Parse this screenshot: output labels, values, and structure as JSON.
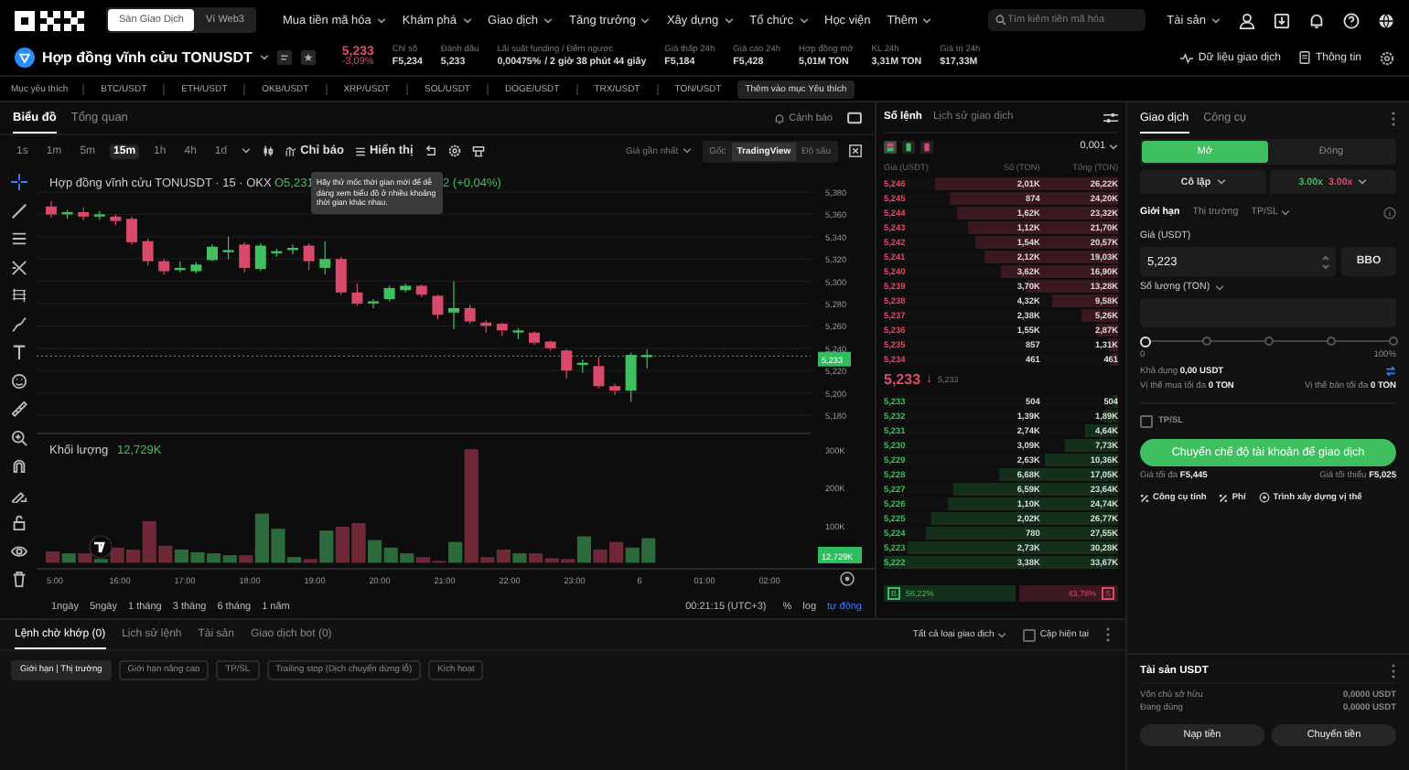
{
  "nav": {
    "exchange_tabs": [
      {
        "label": "Sàn Giao Dịch",
        "selected": true
      },
      {
        "label": "Ví Web3",
        "selected": false
      }
    ],
    "menu": [
      {
        "label": "Mua tiền mã hóa",
        "dropdown": true
      },
      {
        "label": "Khám phá",
        "dropdown": true
      },
      {
        "label": "Giao dịch",
        "dropdown": true
      },
      {
        "label": "Tăng trưởng",
        "dropdown": true
      },
      {
        "label": "Xây dựng",
        "dropdown": true
      },
      {
        "label": "Tổ chức",
        "dropdown": true
      },
      {
        "label": "Học viện",
        "dropdown": false
      },
      {
        "label": "Thêm",
        "dropdown": true
      }
    ],
    "search": {
      "placeholder": "Tìm kiếm tiền mã hóa"
    },
    "assets": "Tài sản"
  },
  "ticker": {
    "title": "Hợp đồng vĩnh cửu TONUSDT",
    "price": "5,233",
    "change": "-3,09%",
    "stats": [
      {
        "kind": "plain",
        "label": "Chỉ số",
        "value": "F5,234"
      },
      {
        "kind": "plain",
        "label": "Đánh dấu",
        "value": "5,233"
      },
      {
        "kind": "funding",
        "label": "Lãi suất funding / Đếm ngược",
        "rate": "0,00475%",
        "countdown": "/ 2 giờ 38 phút 44 giây"
      },
      {
        "kind": "plain",
        "label": "Giá thấp 24h",
        "value": "F5,184"
      },
      {
        "kind": "plain",
        "label": "Giá cao 24h",
        "value": "F5,428"
      },
      {
        "kind": "plain",
        "label": "Hợp đồng mở",
        "value": "5,01M TON"
      },
      {
        "kind": "plain",
        "label": "KL 24h",
        "value": "3,31M TON"
      },
      {
        "kind": "plain",
        "label": "Giá trị 24h",
        "value": "$17,33M"
      }
    ],
    "actions": [
      "Dữ liệu giao dịch",
      "Thông tin"
    ]
  },
  "favorites": {
    "label": "Mục yêu thích",
    "pairs": [
      "BTC/USDT",
      "ETH/USDT",
      "OKB/USDT",
      "XRP/USDT",
      "SOL/USDT",
      "DOGE/USDT",
      "TRX/USDT",
      "TON/USDT"
    ],
    "add_button": "Thêm vào mục Yêu thích"
  },
  "chart": {
    "tabs": [
      {
        "label": "Biểu đồ",
        "selected": true
      },
      {
        "label": "Tổng quan",
        "selected": false
      }
    ],
    "alert": "Cảnh báo",
    "timeframes": [
      {
        "label": "1s",
        "selected": false
      },
      {
        "label": "1m",
        "selected": false
      },
      {
        "label": "5m",
        "selected": false
      },
      {
        "label": "15m",
        "selected": true
      },
      {
        "label": "1h",
        "selected": false
      },
      {
        "label": "4h",
        "selected": false
      },
      {
        "label": "1d",
        "selected": false
      }
    ],
    "indicators": "Chỉ báo",
    "display": "Hiển thị",
    "price_source": "Giá gần nhất",
    "views": [
      {
        "label": "Gốc",
        "selected": false
      },
      {
        "label": "TradingView",
        "selected": true
      },
      {
        "label": "Độ sâu",
        "selected": false
      }
    ],
    "legend": {
      "title": "Hợp đồng vĩnh cửu TONUSDT · 15 · OKX",
      "open": "O5,231",
      "change": "2 (+0,04%)"
    },
    "tooltip": "Hãy thử mốc thời gian mới để dễ dàng xem biểu đồ ở nhiều khoảng thời gian khác nhau.",
    "price_ticks": [
      "5,380",
      "5,360",
      "5,340",
      "5,320",
      "5,300",
      "5,280",
      "5,260",
      "5,240",
      "5,220",
      "5,200",
      "5,180"
    ],
    "last_price": "5,233",
    "volume_label": "Khối lượng",
    "volume_value": "12,729K",
    "volume_ticks": [
      "300K",
      "200K",
      "100K"
    ],
    "volume_tag": "12,729K",
    "time_labels": [
      "5:00",
      "16:00",
      "17:00",
      "18:00",
      "19:00",
      "20:00",
      "21:00",
      "22:00",
      "23:00",
      "6",
      "01:00",
      "02:00"
    ],
    "ranges": [
      "1ngày",
      "5ngày",
      "1 tháng",
      "3 tháng",
      "6 tháng",
      "1 năm"
    ],
    "clock": "00:21:15 (UTC+3)",
    "scale_options": [
      {
        "label": "%",
        "selected": false
      },
      {
        "label": "log",
        "selected": false
      },
      {
        "label": "tự động",
        "selected": true
      }
    ]
  },
  "orderbook": {
    "tabs": [
      {
        "label": "Sổ lệnh",
        "selected": true
      },
      {
        "label": "Lịch sử giao dịch",
        "selected": false
      }
    ],
    "step": "0,001",
    "columns": [
      "Giá (USDT)",
      "Số (TON)",
      "Tổng (TON)"
    ],
    "asks": [
      {
        "price": "5,246",
        "size": "2,01K",
        "total": "26,22K",
        "level": 0.78
      },
      {
        "price": "5,245",
        "size": "874",
        "total": "24,20K",
        "level": 0.72
      },
      {
        "price": "5,244",
        "size": "1,62K",
        "total": "23,32K",
        "level": 0.69
      },
      {
        "price": "5,243",
        "size": "1,12K",
        "total": "21,70K",
        "level": 0.64
      },
      {
        "price": "5,242",
        "size": "1,54K",
        "total": "20,57K",
        "level": 0.61
      },
      {
        "price": "5,241",
        "size": "2,12K",
        "total": "19,03K",
        "level": 0.57
      },
      {
        "price": "5,240",
        "size": "3,62K",
        "total": "16,90K",
        "level": 0.5
      },
      {
        "price": "5,239",
        "size": "3,70K",
        "total": "13,28K",
        "level": 0.39
      },
      {
        "price": "5,238",
        "size": "4,32K",
        "total": "9,58K",
        "level": 0.28
      },
      {
        "price": "5,237",
        "size": "2,38K",
        "total": "5,26K",
        "level": 0.16
      },
      {
        "price": "5,236",
        "size": "1,55K",
        "total": "2,87K",
        "level": 0.09
      },
      {
        "price": "5,235",
        "size": "857",
        "total": "1,31K",
        "level": 0.04
      },
      {
        "price": "5,234",
        "size": "461",
        "total": "461",
        "level": 0.02
      }
    ],
    "last_price": "5,233",
    "arrow": "↓",
    "mark_price": "5,233",
    "bids": [
      {
        "price": "5,233",
        "size": "504",
        "total": "504",
        "level": 0.02
      },
      {
        "price": "5,232",
        "size": "1,39K",
        "total": "1,89K",
        "level": 0.06
      },
      {
        "price": "5,231",
        "size": "2,74K",
        "total": "4,64K",
        "level": 0.14
      },
      {
        "price": "5,230",
        "size": "3,09K",
        "total": "7,73K",
        "level": 0.23
      },
      {
        "price": "5,229",
        "size": "2,63K",
        "total": "10,36K",
        "level": 0.31
      },
      {
        "price": "5,228",
        "size": "6,68K",
        "total": "17,05K",
        "level": 0.51
      },
      {
        "price": "5,227",
        "size": "6,59K",
        "total": "23,64K",
        "level": 0.7
      },
      {
        "price": "5,226",
        "size": "1,10K",
        "total": "24,74K",
        "level": 0.73
      },
      {
        "price": "5,225",
        "size": "2,02K",
        "total": "26,77K",
        "level": 0.8
      },
      {
        "price": "5,224",
        "size": "780",
        "total": "27,55K",
        "level": 0.82
      },
      {
        "price": "5,223",
        "size": "2,73K",
        "total": "30,28K",
        "level": 0.9
      },
      {
        "price": "5,222",
        "size": "3,38K",
        "total": "33,67K",
        "level": 1
      }
    ],
    "ratio": {
      "buy_label": "B",
      "buy": "56,22%",
      "sell": "43,78%",
      "sell_label": "S",
      "level": 0.5622
    }
  },
  "trade": {
    "tabs": [
      {
        "label": "Giao dịch",
        "selected": true
      },
      {
        "label": "Công cụ",
        "selected": false
      }
    ],
    "sides": [
      {
        "label": "Mở",
        "selected": true
      },
      {
        "label": "Đóng",
        "selected": false
      }
    ],
    "margin_mode": "Cô lập",
    "leverage_long": "3.00x",
    "leverage_short": "3.00x",
    "order_types": [
      {
        "label": "Giới hạn",
        "selected": true,
        "dropdown": false
      },
      {
        "label": "Thị trường",
        "selected": false,
        "dropdown": false
      },
      {
        "label": "TP/SL",
        "selected": false,
        "dropdown": true
      }
    ],
    "price_label": "Giá (USDT)",
    "price_value": "5,223",
    "bbo": "BBO",
    "amount_label": "Số lượng (TON)",
    "slider": {
      "level": 0,
      "min": "0",
      "max": "100%"
    },
    "available_label": "Khả dụng",
    "available": "0,00 USDT",
    "max_buy_label": "Vị thế mua tối đa",
    "max_buy": "0 TON",
    "max_sell_label": "Vị thế bán tối đa",
    "max_sell": "0 TON",
    "tpsl": {
      "label": "TP/SL",
      "checked": false
    },
    "submit": "Chuyển chế độ tài khoản để giao dịch",
    "max_price_label": "Giá tối đa",
    "max_price": "F5,445",
    "min_price_label": "Giá tối thiểu",
    "min_price": "F5,025",
    "tools": [
      "Công cụ tính",
      "Phí",
      "Trình xây dựng vị thế"
    ]
  },
  "orders": {
    "tabs": [
      {
        "label": "Lệnh chờ khớp (0)",
        "selected": true
      },
      {
        "label": "Lịch sử lệnh",
        "selected": false
      },
      {
        "label": "Tài sản",
        "selected": false
      },
      {
        "label": "Giao dịch bot (0)",
        "selected": false
      }
    ],
    "filter": "Tất cả loại giao dịch",
    "current_pair": {
      "label": "Cặp hiện tại",
      "checked": false
    },
    "chips": [
      {
        "label": "Giới hạn | Thị trường",
        "selected": true
      },
      {
        "label": "Giới hạn nâng cao",
        "selected": false
      },
      {
        "label": "TP/SL",
        "selected": false
      },
      {
        "label": "Trailing stop (Dịch chuyển dừng lỗ)",
        "selected": false
      },
      {
        "label": "Kích hoạt",
        "selected": false
      }
    ]
  },
  "assets": {
    "title": "Tài sản USDT",
    "rows": [
      {
        "label": "Vốn chủ sở hữu",
        "value": "0,0000 USDT"
      },
      {
        "label": "Đang dùng",
        "value": "0,0000 USDT"
      }
    ],
    "buttons": [
      "Nạp tiền",
      "Chuyển tiền"
    ]
  }
}
